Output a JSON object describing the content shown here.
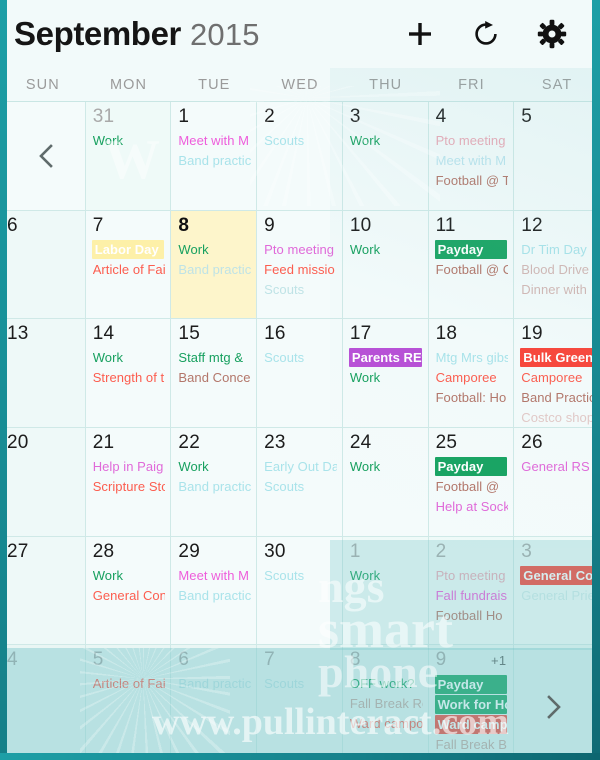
{
  "header": {
    "month": "September",
    "year": "2015",
    "add_label": "+",
    "icons": {
      "add": "plus-icon",
      "refresh": "refresh-icon",
      "settings": "gear-icon"
    }
  },
  "weekdays": [
    "SUN",
    "MON",
    "TUE",
    "WED",
    "THU",
    "FRI",
    "SAT"
  ],
  "nav": {
    "prev_label": "‹",
    "next_label": "›"
  },
  "colors": {
    "accent_teal": "#1d9fa6",
    "today_bg": "#fdf5cb",
    "green": "#19a463",
    "green_text": "#17a05f",
    "red": "#f9453a",
    "red_text": "#fc5d4f",
    "purple": "#b84fd6",
    "pink_text": "#e06ad9",
    "magenta_text": "#ee5ddb",
    "brown_text": "#b3766a",
    "cyan_text": "#a9e3ea",
    "grey_text": "#cbbfbf"
  },
  "weeks": [
    {
      "days": [
        {
          "num": "",
          "type": "blank",
          "events": []
        },
        {
          "num": "31",
          "type": "other",
          "events": [
            {
              "text": "Work",
              "color": "#17a05f",
              "style": "text"
            }
          ]
        },
        {
          "num": "1",
          "type": "cur",
          "events": [
            {
              "text": "Meet with M",
              "color": "#ee5ddb",
              "style": "text"
            },
            {
              "text": "Band practic",
              "color": "#a9e3ea",
              "style": "text"
            }
          ]
        },
        {
          "num": "2",
          "type": "cur",
          "events": [
            {
              "text": "Scouts",
              "color": "#a9e3ea",
              "style": "text"
            }
          ]
        },
        {
          "num": "3",
          "type": "cur",
          "events": [
            {
              "text": "Work",
              "color": "#17a05f",
              "style": "text"
            }
          ]
        },
        {
          "num": "4",
          "type": "cur",
          "events": [
            {
              "text": "Pto meeting",
              "color": "#eaa9b6",
              "style": "text"
            },
            {
              "text": "Meet with M",
              "color": "#bce4ee",
              "style": "text"
            },
            {
              "text": "Football @ T",
              "color": "#b3766a",
              "style": "text"
            }
          ]
        },
        {
          "num": "5",
          "type": "cur",
          "events": []
        }
      ]
    },
    {
      "days": [
        {
          "num": "6",
          "type": "sun",
          "events": []
        },
        {
          "num": "7",
          "type": "cur",
          "events": [
            {
              "text": "Labor Day",
              "color": "#fdf0a8",
              "style": "filled",
              "textcolor": "#1c1c1c"
            },
            {
              "text": "Article of Fai",
              "color": "#fc5d4f",
              "style": "text"
            }
          ]
        },
        {
          "num": "8",
          "type": "today",
          "events": [
            {
              "text": "Work",
              "color": "#17a05f",
              "style": "text"
            },
            {
              "text": "Band practic",
              "color": "#bfe3e6",
              "style": "text"
            }
          ]
        },
        {
          "num": "9",
          "type": "cur",
          "events": [
            {
              "text": "Pto meeting",
              "color": "#e06ad9",
              "style": "text"
            },
            {
              "text": "Feed missio",
              "color": "#fc5d4f",
              "style": "text"
            },
            {
              "text": "Scouts",
              "color": "#bfe3e6",
              "style": "text"
            }
          ]
        },
        {
          "num": "10",
          "type": "cur",
          "events": [
            {
              "text": "Work",
              "color": "#17a05f",
              "style": "text"
            }
          ]
        },
        {
          "num": "11",
          "type": "cur",
          "events": [
            {
              "text": "Payday",
              "color": "#19a463",
              "style": "filled"
            },
            {
              "text": "Football @ C",
              "color": "#b3766a",
              "style": "text"
            }
          ]
        },
        {
          "num": "12",
          "type": "cur",
          "events": [
            {
              "text": "Dr Tim Day",
              "color": "#a9e3ea",
              "style": "text"
            },
            {
              "text": "Blood Drive",
              "color": "#d3b7b4",
              "style": "text"
            },
            {
              "text": "Dinner with",
              "color": "#d3b7b4",
              "style": "text"
            }
          ]
        }
      ]
    },
    {
      "days": [
        {
          "num": "13",
          "type": "sun",
          "events": []
        },
        {
          "num": "14",
          "type": "cur",
          "events": [
            {
              "text": "Work",
              "color": "#17a05f",
              "style": "text"
            },
            {
              "text": "Strength of t",
              "color": "#fc5d4f",
              "style": "text"
            }
          ]
        },
        {
          "num": "15",
          "type": "cur",
          "events": [
            {
              "text": "Staff mtg &",
              "color": "#17a05f",
              "style": "text"
            },
            {
              "text": "Band Concer",
              "color": "#b3766a",
              "style": "text"
            }
          ]
        },
        {
          "num": "16",
          "type": "cur",
          "events": [
            {
              "text": "Scouts",
              "color": "#a9e3ea",
              "style": "text"
            }
          ]
        },
        {
          "num": "17",
          "type": "cur",
          "events": [
            {
              "text": "Parents REtur",
              "color": "#b84fd6",
              "style": "filled"
            },
            {
              "text": "Work",
              "color": "#17a05f",
              "style": "text"
            }
          ]
        },
        {
          "num": "18",
          "type": "cur",
          "events": [
            {
              "text": "Mtg Mrs gibs",
              "color": "#a9e3ea",
              "style": "text"
            },
            {
              "text": "Camporee",
              "color": "#fc5d4f",
              "style": "text"
            },
            {
              "text": "Football:  Ho",
              "color": "#b3766a",
              "style": "text"
            }
          ]
        },
        {
          "num": "19",
          "type": "cur",
          "events": [
            {
              "text": "Bulk Green W",
              "color": "#f9453a",
              "style": "filled"
            },
            {
              "text": "Camporee",
              "color": "#fc5d4f",
              "style": "text"
            },
            {
              "text": "Band Practic",
              "color": "#b3766a",
              "style": "text"
            },
            {
              "text": "Costco shop",
              "color": "#e2c9c7",
              "style": "text"
            }
          ]
        }
      ]
    },
    {
      "days": [
        {
          "num": "20",
          "type": "sun",
          "events": []
        },
        {
          "num": "21",
          "type": "cur",
          "events": [
            {
              "text": "Help in Paig",
              "color": "#e06ad9",
              "style": "text"
            },
            {
              "text": "Scripture Sto",
              "color": "#fc5d4f",
              "style": "text"
            }
          ]
        },
        {
          "num": "22",
          "type": "cur",
          "events": [
            {
              "text": "Work",
              "color": "#17a05f",
              "style": "text"
            },
            {
              "text": "Band practic",
              "color": "#a9e3ea",
              "style": "text"
            }
          ]
        },
        {
          "num": "23",
          "type": "cur",
          "events": [
            {
              "text": "Early Out Da",
              "color": "#a9e3ea",
              "style": "text"
            },
            {
              "text": "Scouts",
              "color": "#a9e3ea",
              "style": "text"
            }
          ]
        },
        {
          "num": "24",
          "type": "cur",
          "events": [
            {
              "text": "Work",
              "color": "#17a05f",
              "style": "text"
            }
          ]
        },
        {
          "num": "25",
          "type": "cur",
          "events": [
            {
              "text": "Payday",
              "color": "#19a463",
              "style": "filled"
            },
            {
              "text": "Football @",
              "color": "#b3766a",
              "style": "text"
            },
            {
              "text": "Help at Sock",
              "color": "#e06ad9",
              "style": "text"
            }
          ]
        },
        {
          "num": "26",
          "type": "cur",
          "events": [
            {
              "text": "General RS",
              "color": "#e06ad9",
              "style": "text"
            }
          ]
        }
      ]
    },
    {
      "days": [
        {
          "num": "27",
          "type": "sun",
          "events": []
        },
        {
          "num": "28",
          "type": "cur",
          "events": [
            {
              "text": "Work",
              "color": "#17a05f",
              "style": "text"
            },
            {
              "text": "General Conf",
              "color": "#fc5d4f",
              "style": "text"
            }
          ]
        },
        {
          "num": "29",
          "type": "cur",
          "events": [
            {
              "text": "Meet with M",
              "color": "#ee5ddb",
              "style": "text"
            },
            {
              "text": "Band practic",
              "color": "#a9e3ea",
              "style": "text"
            }
          ]
        },
        {
          "num": "30",
          "type": "cur",
          "events": [
            {
              "text": "Scouts",
              "color": "#a9e3ea",
              "style": "text"
            }
          ]
        },
        {
          "num": "1",
          "type": "other",
          "events": [
            {
              "text": "Work",
              "color": "#17a05f",
              "style": "text"
            }
          ]
        },
        {
          "num": "2",
          "type": "other",
          "events": [
            {
              "text": "Pto meeting",
              "color": "#eaa9b6",
              "style": "text"
            },
            {
              "text": "Fall fundrais",
              "color": "#ee5ddb",
              "style": "text"
            },
            {
              "text": "Football Ho",
              "color": "#b3766a",
              "style": "text"
            }
          ]
        },
        {
          "num": "3",
          "type": "other",
          "events": [
            {
              "text": "General Conf",
              "color": "#f9453a",
              "style": "filled"
            },
            {
              "text": "General Prie",
              "color": "#cfeaea",
              "style": "text"
            }
          ]
        }
      ]
    },
    {
      "days": [
        {
          "num": "4",
          "type": "outside",
          "events": []
        },
        {
          "num": "5",
          "type": "outside",
          "events": [
            {
              "text": "Article of Fai",
              "color": "#fc5d4f",
              "style": "text"
            }
          ]
        },
        {
          "num": "6",
          "type": "outside",
          "events": [
            {
              "text": "Band practic",
              "color": "#bfe3e6",
              "style": "text"
            }
          ]
        },
        {
          "num": "7",
          "type": "outside",
          "events": [
            {
              "text": "Scouts",
              "color": "#bfe3e6",
              "style": "text"
            }
          ]
        },
        {
          "num": "8",
          "type": "outside",
          "events": [
            {
              "text": "OFF work?",
              "color": "#17a05f",
              "style": "text"
            },
            {
              "text": "Fall Break Re",
              "color": "#c8a8a2",
              "style": "text"
            },
            {
              "text": "Ward campo",
              "color": "#fc5d4f",
              "style": "text"
            }
          ]
        },
        {
          "num": "9",
          "type": "outside",
          "more": "+1",
          "events": [
            {
              "text": "Payday",
              "color": "#19a463",
              "style": "filled"
            },
            {
              "text": "Work for Holl",
              "color": "#19a463",
              "style": "filled"
            },
            {
              "text": "Ward campou",
              "color": "#f9453a",
              "style": "filled"
            },
            {
              "text": "Fall Break B",
              "color": "#c8a8a2",
              "style": "text"
            }
          ]
        },
        {
          "num": "",
          "type": "outside",
          "events": []
        }
      ]
    }
  ],
  "watermark": {
    "line1": "ngs",
    "line2": "smart",
    "line3": "phone",
    "url": "www.pullinteract.com",
    "letter": "W"
  }
}
